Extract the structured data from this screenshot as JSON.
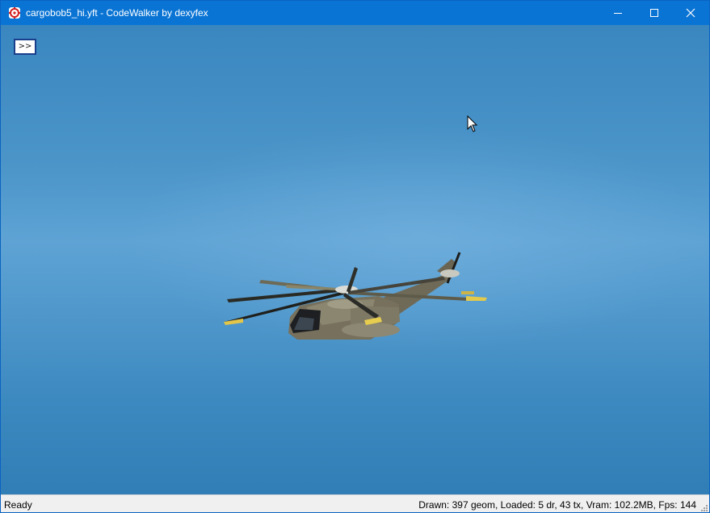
{
  "window": {
    "title": "cargobob5_hi.yft - CodeWalker by dexyfex",
    "app_icon": "codewalker-app-icon",
    "titlebar_color": "#0a74d4",
    "controls": {
      "minimize_icon": "minimize-icon",
      "maximize_icon": "maximize-icon",
      "close_icon": "close-icon"
    }
  },
  "viewport": {
    "toggle_button_label": ">>",
    "sky_color": "#4b95c9",
    "model": "helicopter-model"
  },
  "statusbar": {
    "status_text": "Ready",
    "stats_text": "Drawn: 397 geom, Loaded: 5 dr, 43 tx, Vram: 102.2MB, Fps: 144"
  }
}
